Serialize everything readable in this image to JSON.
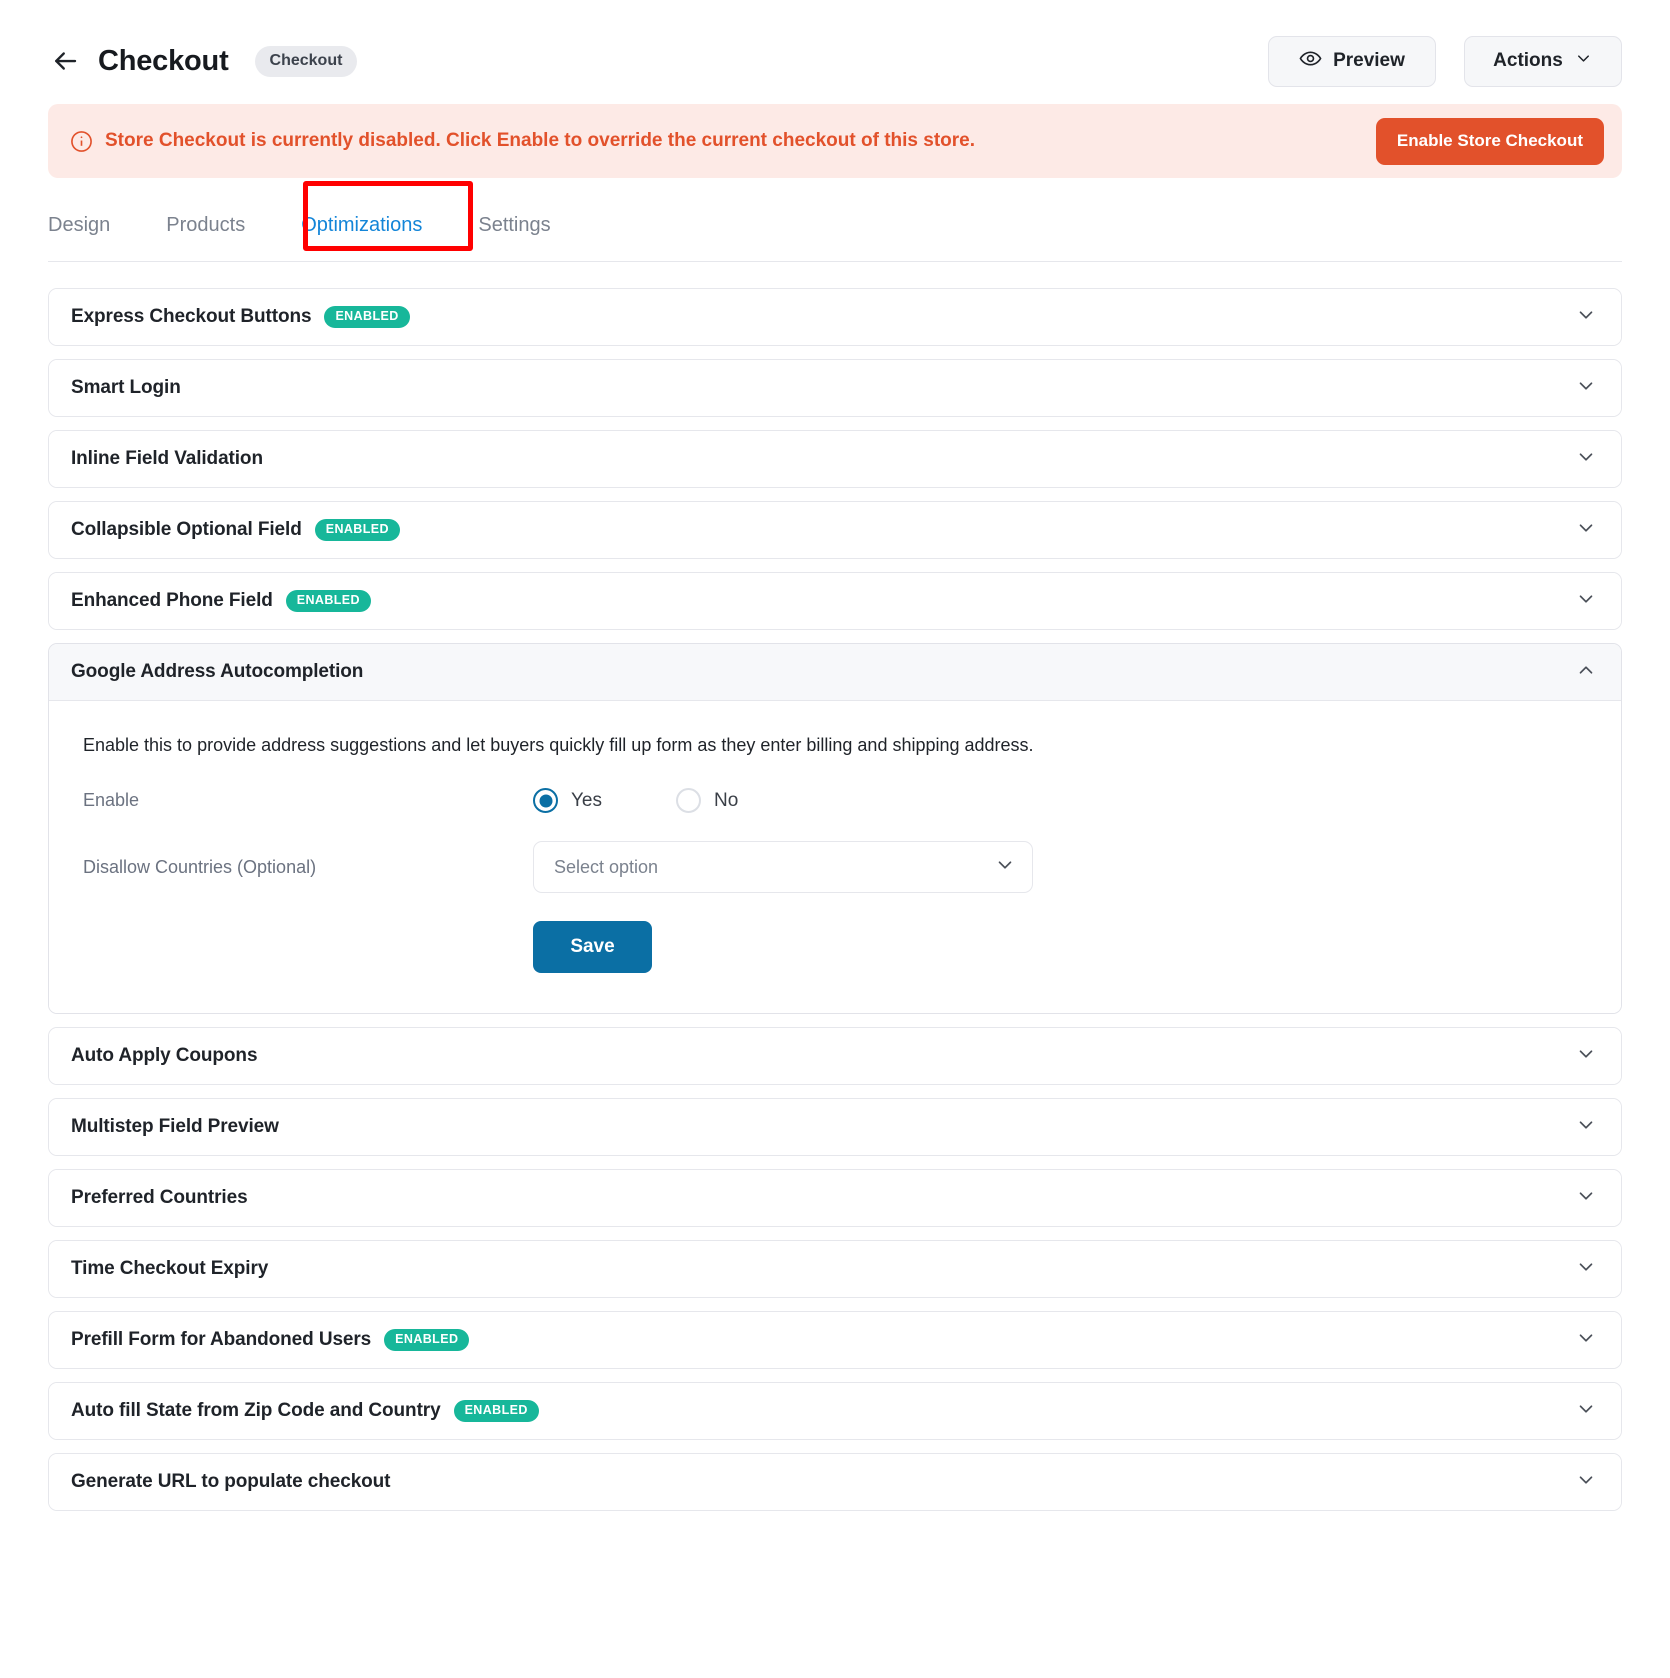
{
  "header": {
    "back_icon": "arrow-left-icon",
    "title": "Checkout",
    "chip": "Checkout",
    "preview_label": "Preview",
    "preview_icon": "eye-icon",
    "actions_label": "Actions",
    "actions_icon": "chevron-down-icon"
  },
  "alert": {
    "icon": "info-circle-icon",
    "message": "Store Checkout is currently disabled. Click Enable to override the current checkout of this store.",
    "button_label": "Enable Store Checkout",
    "text_color": "#e2512b",
    "bg_color": "#fdeae6",
    "button_color": "#e2512b"
  },
  "tabs": {
    "items": [
      {
        "label": "Design",
        "active": false
      },
      {
        "label": "Products",
        "active": false
      },
      {
        "label": "Optimizations",
        "active": true
      },
      {
        "label": "Settings",
        "active": false
      }
    ],
    "active_color": "#1385d8",
    "highlight_color": "#ff0000"
  },
  "badge_text": "ENABLED",
  "badge_color": "#17b79a",
  "sections": [
    {
      "title": "Express Checkout Buttons",
      "badge": "ENABLED",
      "expanded": false
    },
    {
      "title": "Smart Login",
      "badge": "",
      "expanded": false
    },
    {
      "title": "Inline Field Validation",
      "badge": "",
      "expanded": false
    },
    {
      "title": "Collapsible Optional Field",
      "badge": "ENABLED",
      "expanded": false
    },
    {
      "title": "Enhanced Phone Field",
      "badge": "ENABLED",
      "expanded": false
    },
    {
      "title": "Google Address Autocompletion",
      "badge": "",
      "expanded": true
    },
    {
      "title": "Auto Apply Coupons",
      "badge": "",
      "expanded": false
    },
    {
      "title": "Multistep Field Preview",
      "badge": "",
      "expanded": false
    },
    {
      "title": "Preferred Countries",
      "badge": "",
      "expanded": false
    },
    {
      "title": "Time Checkout Expiry",
      "badge": "",
      "expanded": false
    },
    {
      "title": "Prefill Form for Abandoned Users",
      "badge": "ENABLED",
      "expanded": false
    },
    {
      "title": "Auto fill State from Zip Code and Country",
      "badge": "ENABLED",
      "expanded": false
    },
    {
      "title": "Generate URL to populate checkout",
      "badge": "",
      "expanded": false
    }
  ],
  "google_address": {
    "description": "Enable this to provide address suggestions and let buyers quickly fill up form as they enter billing and shipping address.",
    "enable_label": "Enable",
    "yes_label": "Yes",
    "no_label": "No",
    "enable_value": "Yes",
    "countries_label": "Disallow Countries (Optional)",
    "countries_placeholder": "Select option",
    "countries_value": "Select option",
    "save_label": "Save",
    "save_color": "#0b6fa4"
  }
}
